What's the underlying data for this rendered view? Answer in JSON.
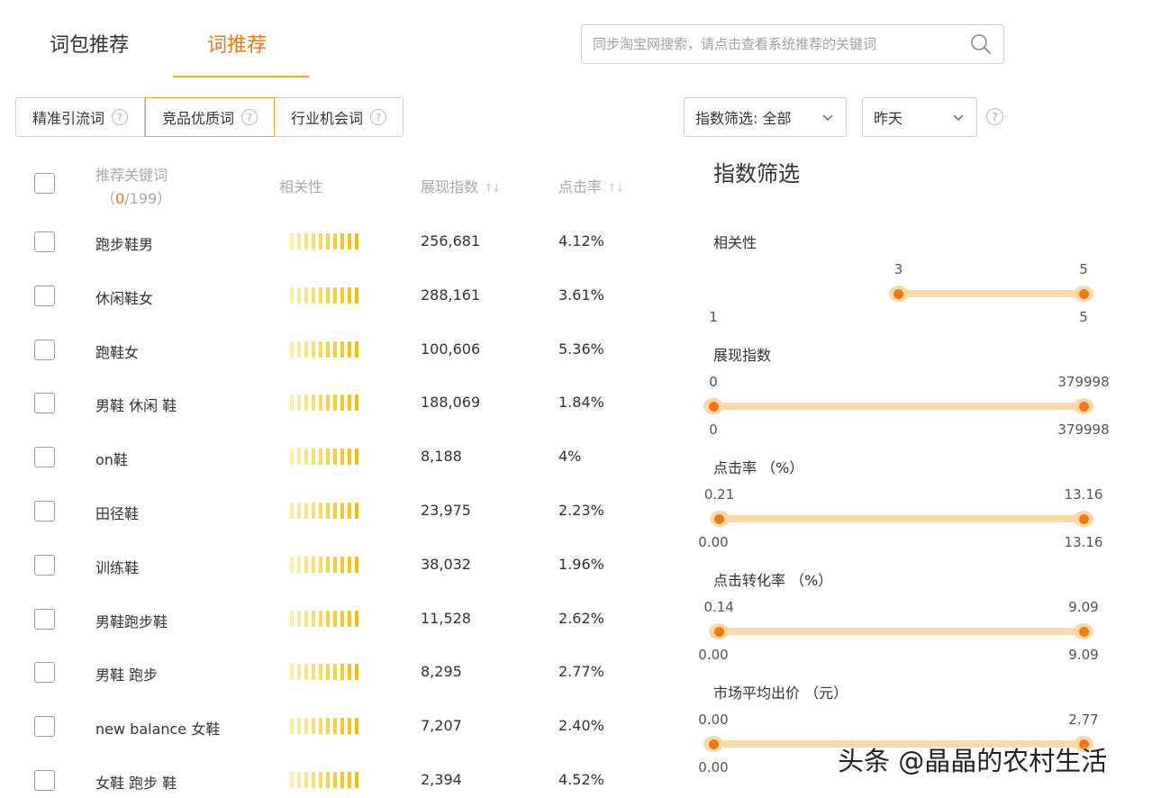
{
  "tabs": [
    {
      "label": "词包推荐",
      "active": false
    },
    {
      "label": "词推荐",
      "active": true
    }
  ],
  "search": {
    "placeholder": "同步淘宝网搜索，请点击查看系统推荐的关键词"
  },
  "subtabs": [
    {
      "label": "精准引流词",
      "active": false
    },
    {
      "label": "竞品优质词",
      "active": true
    },
    {
      "label": "行业机会词",
      "active": false
    }
  ],
  "dropdowns": {
    "index_filter": "指数筛选: 全部",
    "date": "昨天"
  },
  "table": {
    "headers": {
      "keyword": "推荐关键词",
      "relevance": "相关性",
      "impressions": "展现指数",
      "ctr": "点击率"
    },
    "count_open": "（",
    "count_selected": "0",
    "count_total": "/199）",
    "rows": [
      {
        "keyword": "跑步鞋男",
        "relevance": 5,
        "impressions": "256,681",
        "ctr": "4.12%"
      },
      {
        "keyword": "休闲鞋女",
        "relevance": 5,
        "impressions": "288,161",
        "ctr": "3.61%"
      },
      {
        "keyword": "跑鞋女",
        "relevance": 5,
        "impressions": "100,606",
        "ctr": "5.36%"
      },
      {
        "keyword": "男鞋 休闲 鞋",
        "relevance": 5,
        "impressions": "188,069",
        "ctr": "1.84%"
      },
      {
        "keyword": "on鞋",
        "relevance": 5,
        "impressions": "8,188",
        "ctr": "4%"
      },
      {
        "keyword": "田径鞋",
        "relevance": 5,
        "impressions": "23,975",
        "ctr": "2.23%"
      },
      {
        "keyword": "训练鞋",
        "relevance": 5,
        "impressions": "38,032",
        "ctr": "1.96%"
      },
      {
        "keyword": "男鞋跑步鞋",
        "relevance": 5,
        "impressions": "11,528",
        "ctr": "2.62%"
      },
      {
        "keyword": "男鞋 跑步",
        "relevance": 5,
        "impressions": "8,295",
        "ctr": "2.77%"
      },
      {
        "keyword": "new balance 女鞋",
        "relevance": 5,
        "impressions": "7,207",
        "ctr": "2.40%"
      },
      {
        "keyword": "女鞋 跑步 鞋",
        "relevance": 5,
        "impressions": "2,394",
        "ctr": "4.52%"
      }
    ]
  },
  "filter_panel": {
    "title": "指数筛选",
    "sliders": [
      {
        "label": "相关性",
        "low": "3",
        "high": "5",
        "min": "1",
        "max": "5",
        "low_fraction": 0.5,
        "high_fraction": 1.0
      },
      {
        "label": "展现指数",
        "low": "0",
        "high": "379998",
        "min": "0",
        "max": "379998",
        "low_fraction": 0.0,
        "high_fraction": 1.0
      },
      {
        "label": "点击率 （%）",
        "low": "0.21",
        "high": "13.16",
        "min": "0.00",
        "max": "13.16",
        "low_fraction": 0.016,
        "high_fraction": 1.0
      },
      {
        "label": "点击转化率 （%）",
        "low": "0.14",
        "high": "9.09",
        "min": "0.00",
        "max": "9.09",
        "low_fraction": 0.015,
        "high_fraction": 1.0
      },
      {
        "label": "市场平均出价 （元）",
        "low": "0.00",
        "high": "2.77",
        "min": "0.00",
        "max": "",
        "low_fraction": 0.0,
        "high_fraction": 1.0
      }
    ]
  },
  "watermark": "头条 @晶晶的农村生活",
  "colors": {
    "accent": "#f5780a",
    "track": "#fcd9a8",
    "bar_light": "#fde99a",
    "bar_dark": "#f7c200"
  }
}
